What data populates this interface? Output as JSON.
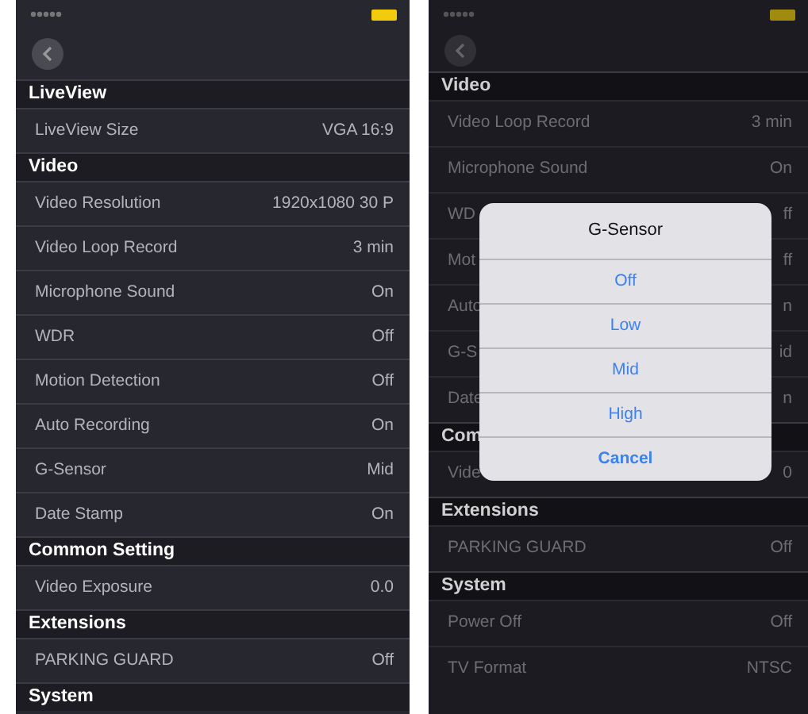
{
  "screens": [
    {
      "dimmed": false,
      "sections": [
        {
          "title": "LiveView",
          "rows": [
            {
              "label": "LiveView Size",
              "value": "VGA 16:9"
            }
          ]
        },
        {
          "title": "Video",
          "rows": [
            {
              "label": "Video Resolution",
              "value": "1920x1080 30 P"
            },
            {
              "label": "Video Loop Record",
              "value": "3 min"
            },
            {
              "label": "Microphone Sound",
              "value": "On"
            },
            {
              "label": "WDR",
              "value": "Off"
            },
            {
              "label": "Motion Detection",
              "value": "Off"
            },
            {
              "label": "Auto Recording",
              "value": "On"
            },
            {
              "label": "G-Sensor",
              "value": "Mid"
            },
            {
              "label": "Date Stamp",
              "value": "On"
            }
          ]
        },
        {
          "title": "Common Setting",
          "rows": [
            {
              "label": "Video Exposure",
              "value": "0.0"
            }
          ]
        },
        {
          "title": "Extensions",
          "rows": [
            {
              "label": "PARKING GUARD",
              "value": "Off"
            }
          ]
        },
        {
          "title": "System"
        }
      ]
    },
    {
      "dimmed": true,
      "sections": [
        {
          "title": "Video",
          "rows": [
            {
              "label": "Video Loop Record",
              "value": "3 min"
            },
            {
              "label": "Microphone Sound",
              "value": "On"
            },
            {
              "label": "WD",
              "value": "ff"
            },
            {
              "label": "Mot",
              "value": "ff"
            },
            {
              "label": "Auto",
              "value": "n"
            },
            {
              "label": "G-S",
              "value": "id"
            },
            {
              "label": "Date",
              "value": "n"
            }
          ]
        },
        {
          "title": "Com",
          "rows": [
            {
              "label": "Vide",
              "value": "0"
            }
          ]
        },
        {
          "title": "Extensions",
          "rows": [
            {
              "label": "PARKING GUARD",
              "value": "Off"
            }
          ]
        },
        {
          "title": "System",
          "rows": [
            {
              "label": "Power Off",
              "value": "Off"
            },
            {
              "label": "TV Format",
              "value": "NTSC"
            }
          ]
        }
      ],
      "dialog": {
        "title": "G-Sensor",
        "options": [
          "Off",
          "Low",
          "Mid",
          "High"
        ],
        "cancel": "Cancel"
      }
    }
  ]
}
